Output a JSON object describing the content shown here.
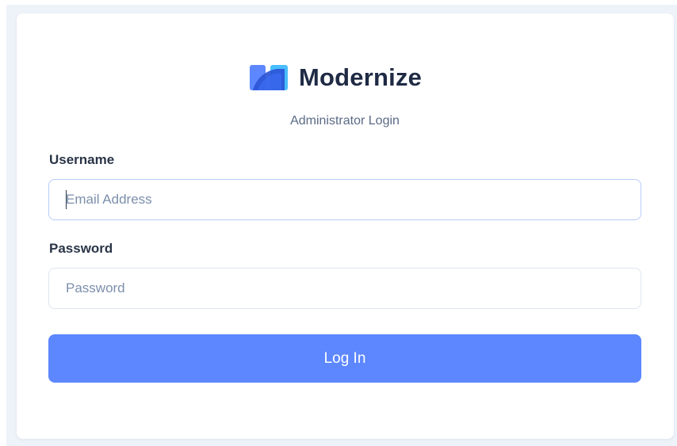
{
  "brand": {
    "name": "Modernize"
  },
  "subtitle": "Administrator Login",
  "form": {
    "username_label": "Username",
    "username_placeholder": "Email Address",
    "password_label": "Password",
    "password_placeholder": "Password",
    "login_label": "Log In"
  },
  "colors": {
    "accent": "#5d87ff",
    "logo_primary": "#5d87ff",
    "logo_secondary": "#49beff",
    "page_background": "#eef2f9"
  }
}
